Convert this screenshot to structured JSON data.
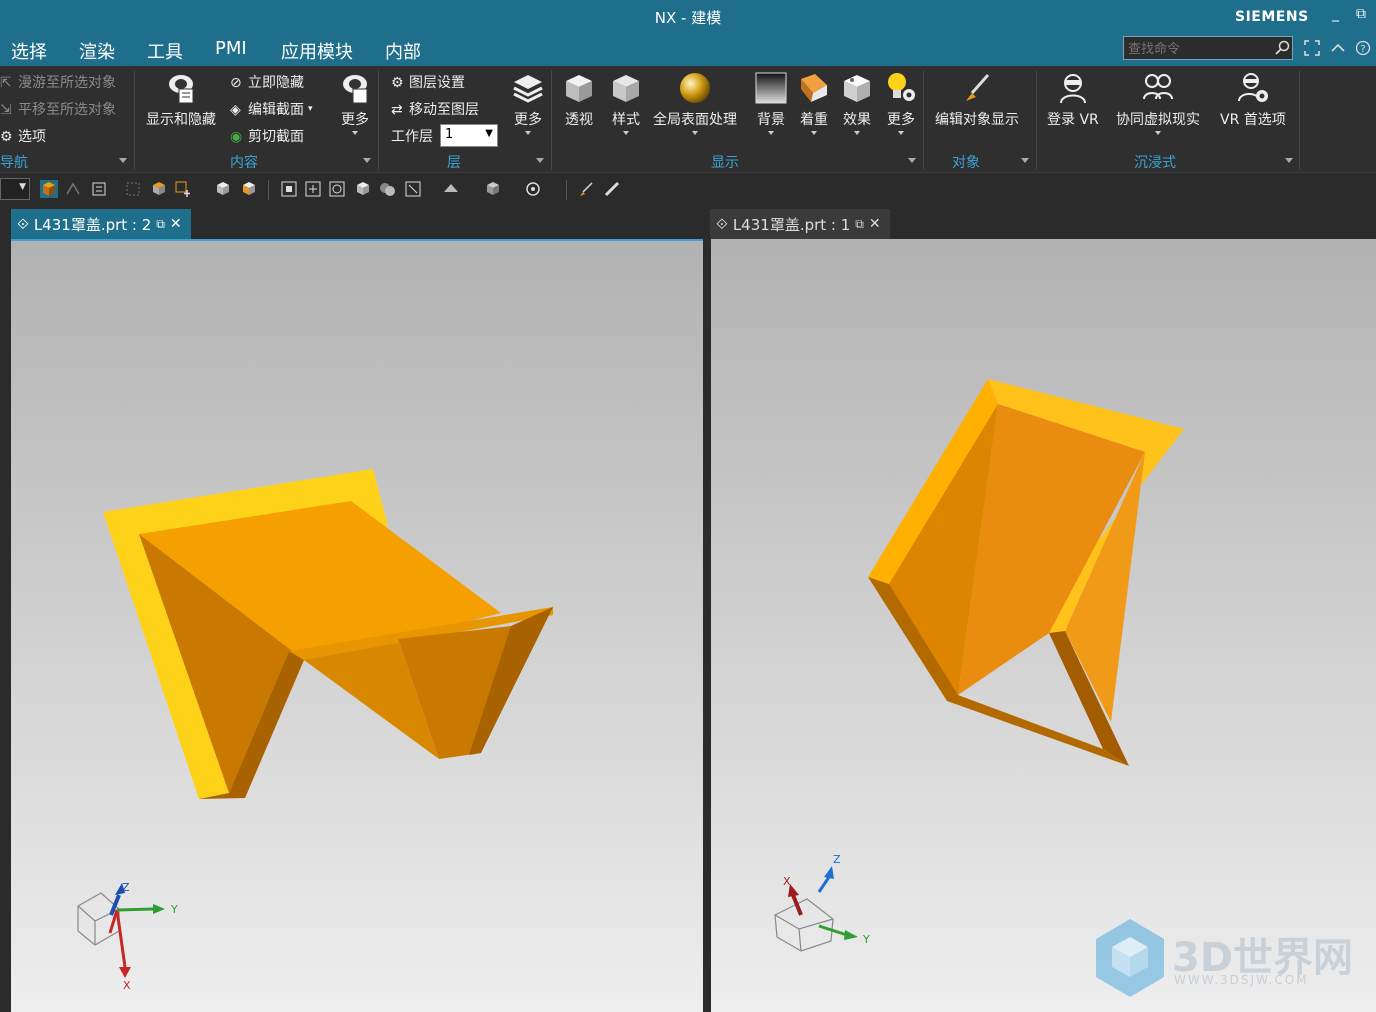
{
  "window": {
    "title": "NX - 建模",
    "brand": "SIEMENS"
  },
  "menu": [
    "选择",
    "渲染",
    "工具",
    "PMI",
    "应用模块",
    "内部"
  ],
  "search": {
    "placeholder": "查找命令"
  },
  "ribbon": {
    "nav": {
      "items": [
        "漫游至所选对象",
        "平移至所选对象",
        "选项"
      ],
      "label": "导航"
    },
    "content": {
      "show_hide": "显示和隐藏",
      "instant_hide": "立即隐藏",
      "edit_section": "编辑截面",
      "clip_section": "剪切截面",
      "more": "更多",
      "label": "内容"
    },
    "layer": {
      "layer_settings": "图层设置",
      "move_to_layer": "移动至图层",
      "work_layer_label": "工作层",
      "work_layer_value": "1",
      "more": "更多",
      "label": "层"
    },
    "display": {
      "items": [
        "透视",
        "样式",
        "全局表面处理",
        "背景",
        "着重",
        "效果",
        "更多"
      ],
      "label": "显示"
    },
    "object": {
      "edit_display": "编辑对象显示",
      "label": "对象"
    },
    "immersive": {
      "items": [
        "登录 VR",
        "协同虚拟现实",
        "VR 首选项"
      ],
      "label": "沉浸式"
    }
  },
  "tabs": [
    {
      "label": "L431罩盖.prt : 2",
      "active": true
    },
    {
      "label": "L431罩盖.prt : 1",
      "active": false
    }
  ],
  "triad": {
    "x": "X",
    "y": "Y",
    "z": "Z"
  },
  "watermark": {
    "main": "3D世界网",
    "sub": "WWW.3DSJW.COM"
  },
  "colors": {
    "title_bar": "#1f6e8c",
    "accent": "#3ba3d5",
    "part_orange": "#f2a000",
    "part_edge": "#ffd21a"
  }
}
